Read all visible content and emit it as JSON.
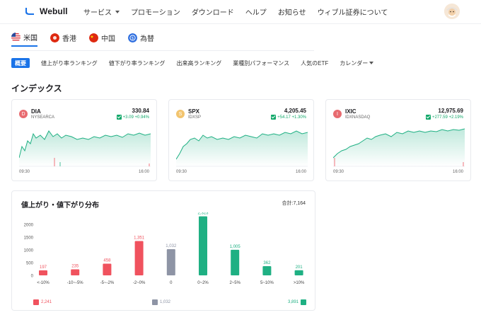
{
  "header": {
    "logo_text": "Webull",
    "nav": [
      "サービス",
      "プロモーション",
      "ダウンロード",
      "ヘルプ",
      "お知らせ",
      "ウィブル証券について"
    ]
  },
  "market_tabs": [
    {
      "label": "米国",
      "active": true
    },
    {
      "label": "香港",
      "active": false
    },
    {
      "label": "中国",
      "active": false
    },
    {
      "label": "為替",
      "active": false
    }
  ],
  "sub_tabs": [
    {
      "label": "概要",
      "active": true
    },
    {
      "label": "値上がり率ランキング",
      "active": false
    },
    {
      "label": "値下がり率ランキング",
      "active": false
    },
    {
      "label": "出来高ランキング",
      "active": false
    },
    {
      "label": "業種別パフォーマンス",
      "active": false
    },
    {
      "label": "人気のETF",
      "active": false
    },
    {
      "label": "カレンダー",
      "active": false
    }
  ],
  "section_title": "インデックス",
  "indices": [
    {
      "letter": "D",
      "symbol": "DIA",
      "exchange": "NYSEARCA",
      "price": "330.84",
      "change": "+3.09 +0.94%",
      "start": "09:30",
      "end": "16:00",
      "dot_color": "#e86b70",
      "dot_color2": "#e86b70"
    },
    {
      "letter": "S",
      "symbol": "SPX",
      "exchange": "IDXSP",
      "price": "4,205.45",
      "change": "+54.17 +1.30%",
      "start": "09:30",
      "end": "16:00",
      "dot_color": "#f2c46e"
    },
    {
      "letter": "I",
      "symbol": "IXIC",
      "exchange": "IDXNASDAQ",
      "price": "12,975.69",
      "change": "+277.59 +2.19%",
      "start": "09:30",
      "end": "16:00",
      "dot_color": "#e86b70"
    }
  ],
  "distribution": {
    "title": "値上がり・値下がり分布",
    "total": "合計:7,164",
    "down_count": "2,241",
    "flat_count": "1,032",
    "up_count": "3,891",
    "colors": {
      "down": "#f0525e",
      "flat": "#8e94a5",
      "up": "#1fb083"
    }
  },
  "chart_data": {
    "type": "bar",
    "categories": [
      "<-10%",
      "-10~-5%",
      "-5~-2%",
      "-2~0%",
      "0",
      "0~2%",
      "2~5%",
      "5~10%",
      ">10%"
    ],
    "values": [
      197,
      235,
      458,
      1351,
      1032,
      2323,
      1005,
      362,
      201
    ],
    "value_labels": [
      "197",
      "235",
      "458",
      "1,351",
      "1,032",
      "2,323",
      "1,005",
      "362",
      "201"
    ],
    "groups": [
      "down",
      "down",
      "down",
      "down",
      "flat",
      "up",
      "up",
      "up",
      "up"
    ],
    "yticks": [
      "0",
      "500",
      "1000",
      "1500",
      "2000"
    ],
    "ylim": [
      0,
      2200
    ],
    "grid": false
  }
}
